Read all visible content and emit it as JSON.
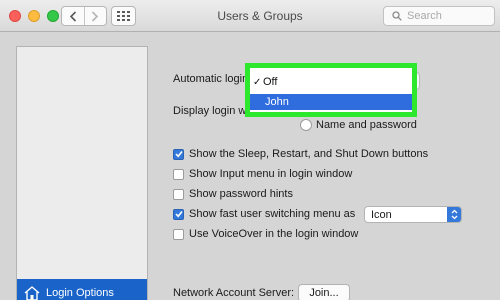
{
  "window": {
    "title": "Users & Groups",
    "search_placeholder": "Search"
  },
  "sidebar": {
    "selected_label": "Login Options"
  },
  "login": {
    "automatic_login_label": "Automatic login:",
    "display_login_label": "Display login window as:",
    "radio_name_password": "Name and password",
    "automatic_login_menu": {
      "items": [
        "Off",
        "John"
      ],
      "checked": "Off",
      "highlighted": "John",
      "check_glyph": "✓"
    }
  },
  "options": {
    "items": [
      {
        "label": "Show the Sleep, Restart, and Shut Down buttons",
        "checked": true
      },
      {
        "label": "Show Input menu in login window",
        "checked": false
      },
      {
        "label": "Show password hints",
        "checked": false
      },
      {
        "label": "Show fast user switching menu as",
        "checked": true
      },
      {
        "label": "Use VoiceOver in the login window",
        "checked": false
      }
    ],
    "fast_switch_value": "Icon"
  },
  "network": {
    "label": "Network Account Server:",
    "join_label": "Join..."
  },
  "colors": {
    "accent": "#3478d9",
    "selection": "#1a64c9",
    "annotation": "#2ee82e"
  }
}
